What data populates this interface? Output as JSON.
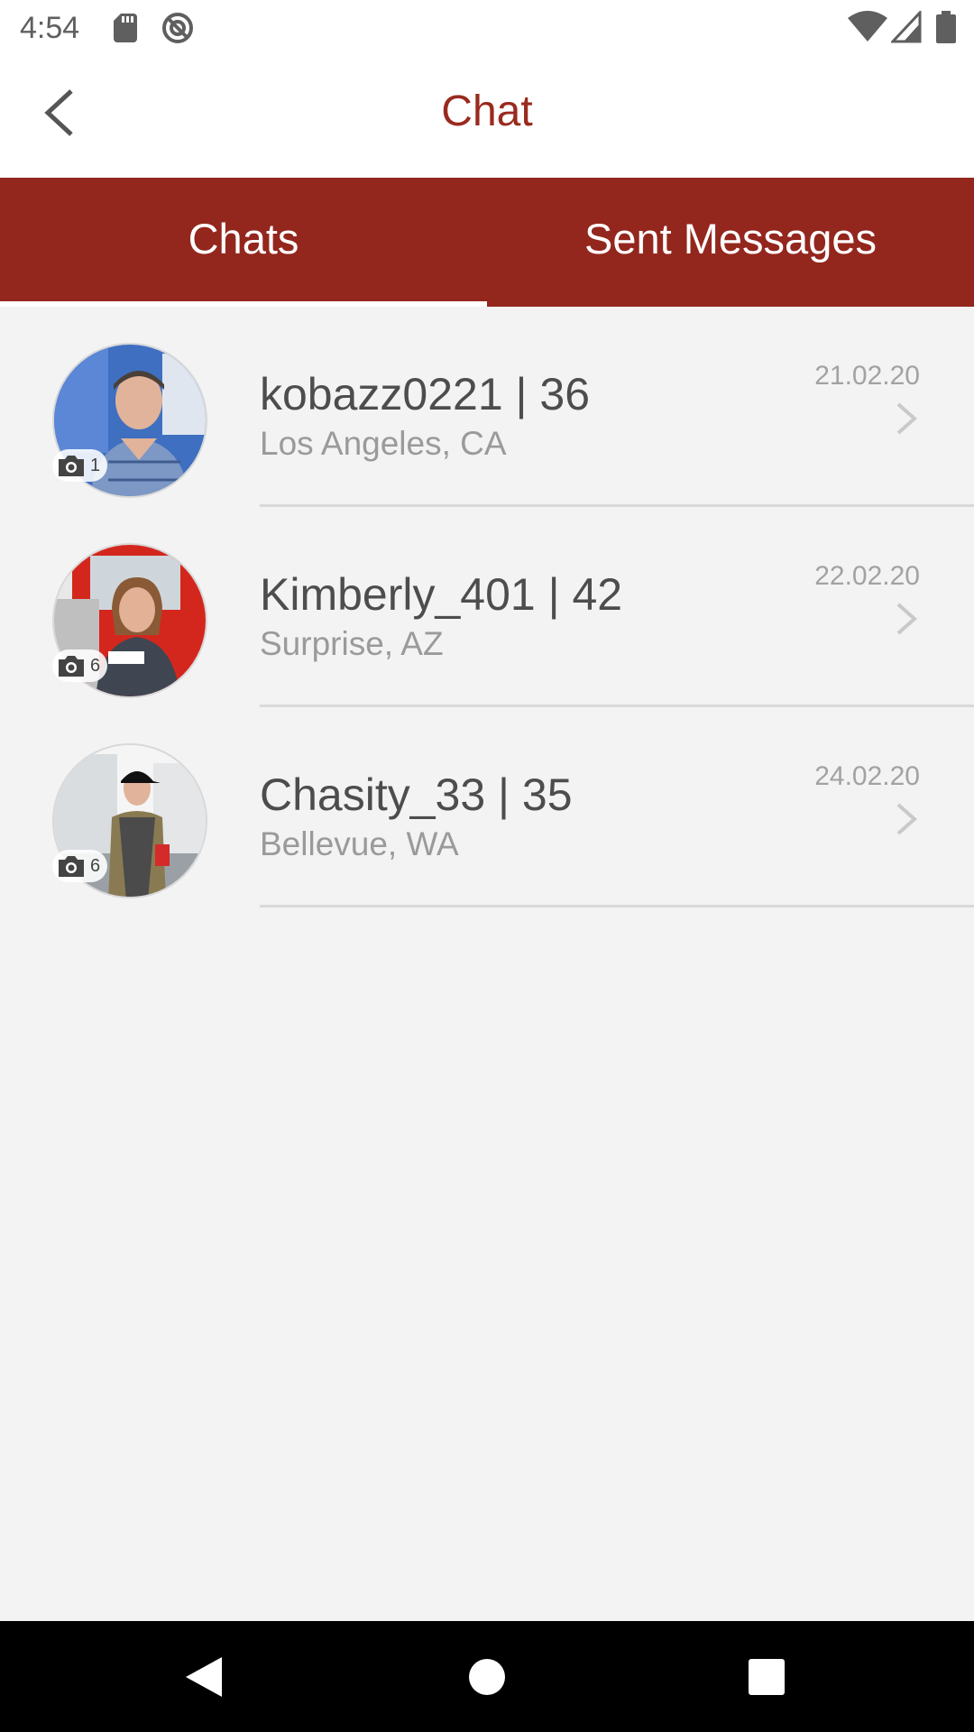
{
  "status_bar": {
    "time": "4:54",
    "icons": [
      "sd-card-icon",
      "sync-icon",
      "wifi-icon",
      "signal-icon",
      "battery-icon"
    ]
  },
  "app_bar": {
    "title": "Chat",
    "back_icon": "chevron-left-icon"
  },
  "tabs": [
    {
      "label": "Chats",
      "active": true
    },
    {
      "label": "Sent Messages",
      "active": false
    }
  ],
  "chats": [
    {
      "name": "kobazz0221 | 36",
      "location": "Los Angeles, CA",
      "date": "21.02.20",
      "photo_count": "1"
    },
    {
      "name": "Kimberly_401 | 42",
      "location": "Surprise, AZ",
      "date": "22.02.20",
      "photo_count": "6"
    },
    {
      "name": "Chasity_33 | 35",
      "location": "Bellevue, WA",
      "date": "24.02.20",
      "photo_count": "6"
    }
  ],
  "colors": {
    "brand": "#93271d",
    "title": "#9a2a1f",
    "background": "#f3f3f3"
  },
  "nav_bar": {
    "buttons": [
      "back-triangle-icon",
      "home-circle-icon",
      "recents-square-icon"
    ]
  }
}
